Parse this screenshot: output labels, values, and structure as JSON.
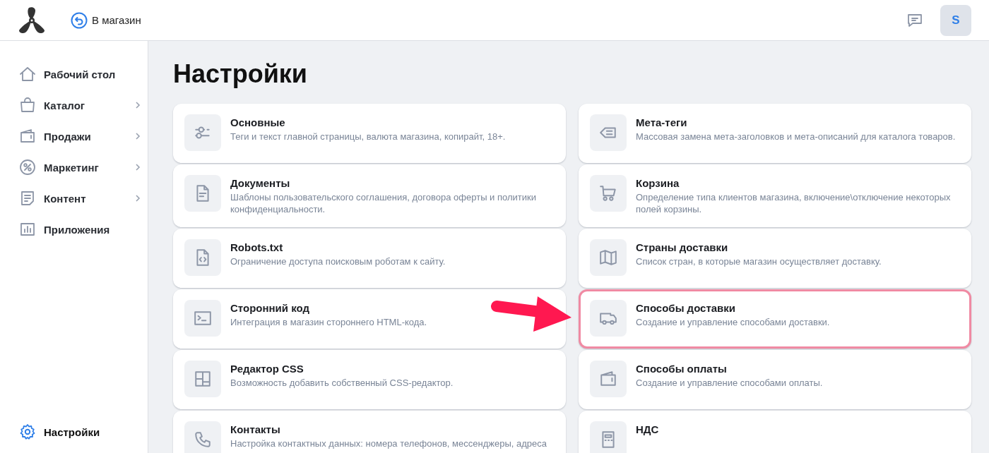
{
  "header": {
    "back_link": "В магазин",
    "avatar": "S"
  },
  "sidebar": {
    "items": [
      {
        "label": "Рабочий стол",
        "expandable": false,
        "selected": false
      },
      {
        "label": "Каталог",
        "expandable": true,
        "selected": false
      },
      {
        "label": "Продажи",
        "expandable": true,
        "selected": false
      },
      {
        "label": "Маркетинг",
        "expandable": true,
        "selected": false
      },
      {
        "label": "Контент",
        "expandable": true,
        "selected": false
      },
      {
        "label": "Приложения",
        "expandable": false,
        "selected": false
      }
    ],
    "footer_item": {
      "label": "Настройки",
      "selected": true
    }
  },
  "page": {
    "title": "Настройки",
    "columns": [
      {
        "cards": [
          {
            "title": "Основные",
            "description": "Теги и текст главной страницы, валюта магазина, копирайт, 18+.",
            "highlighted": false
          },
          {
            "title": "Документы",
            "description": "Шаблоны пользовательского соглашения, договора оферты и политики конфиденциальности.",
            "highlighted": false
          },
          {
            "title": "Robots.txt",
            "description": "Ограничение доступа поисковым роботам к сайту.",
            "highlighted": false
          },
          {
            "title": "Сторонний код",
            "description": "Интеграция в магазин стороннего HTML-кода.",
            "highlighted": false
          },
          {
            "title": "Редактор CSS",
            "description": "Возможность добавить собственный CSS-редактор.",
            "highlighted": false
          },
          {
            "title": "Контакты",
            "description": "Настройка контактных данных: номера телефонов, мессенджеры, адреса",
            "highlighted": false
          }
        ]
      },
      {
        "cards": [
          {
            "title": "Мета-теги",
            "description": "Массовая замена мета-заголовков и мета-описаний для каталога товаров.",
            "highlighted": false
          },
          {
            "title": "Корзина",
            "description": "Определение типа клиентов магазина, включение\\отключение некоторых полей корзины.",
            "highlighted": false
          },
          {
            "title": "Страны доставки",
            "description": "Список стран, в которые магазин осуществляет доставку.",
            "highlighted": false
          },
          {
            "title": "Способы доставки",
            "description": "Создание и управление способами доставки.",
            "highlighted": true
          },
          {
            "title": "Способы оплаты",
            "description": "Создание и управление способами оплаты.",
            "highlighted": false
          },
          {
            "title": "НДС",
            "highlighted": false
          }
        ]
      }
    ]
  }
}
